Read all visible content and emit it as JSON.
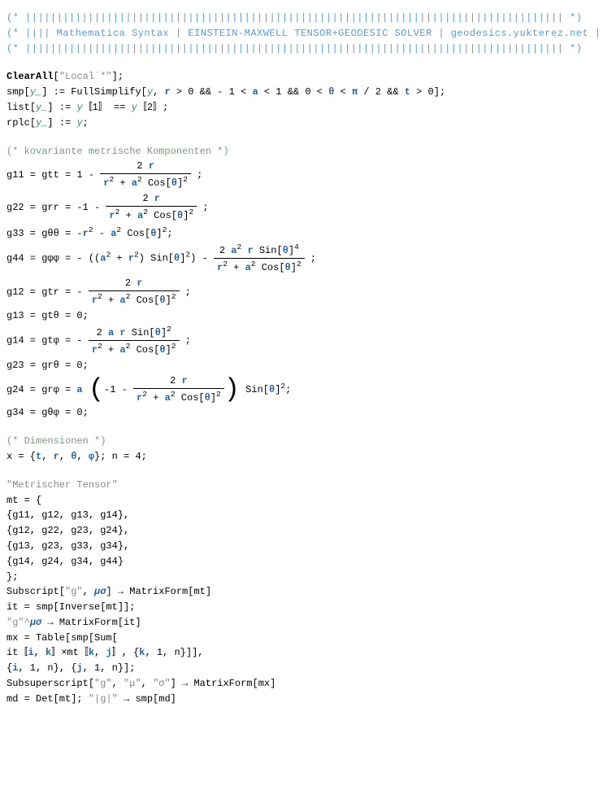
{
  "banner": {
    "line1": "(*  ||||||||||||||||||||||||||||||||||||||||||||||||||||||||||||||||||||||||||||||||||||||  *)",
    "line2": "(*  |||| Mathematica Syntax | EINSTEIN-MAXWELL TENSOR+GEODESIC SOLVER | geodesics.yukterez.net ||||  *)",
    "line3": "(*  ||||||||||||||||||||||||||||||||||||||||||||||||||||||||||||||||||||||||||||||||||||||  *)"
  },
  "code": {
    "clearall": {
      "fn": "ClearAll",
      "arg": "\"Local`*\"",
      "end": ";"
    },
    "smp": {
      "lhs_a": "smp",
      "lhs_b": "[",
      "pat": "y_",
      "lhs_c": "] :=",
      "rhs_a": "FullSimplify",
      "rhs_b": "[",
      "y": "y",
      "sep1": ", ",
      "r": "r",
      "cond1": " > 0 && - 1 < ",
      "a": "a",
      "cond2": " < 1 && 0 < ",
      "th": "θ",
      "cond3": " < ",
      "pi": "π",
      "cond4": " / 2 && ",
      "t": "t",
      "cond5": " > 0];"
    },
    "list": {
      "lhs": "list",
      "pat": "y_",
      "mid": "] := ",
      "y1": "y",
      "br1": "〚1〛 == ",
      "y2": "y",
      "br2": "〚2〛;"
    },
    "rplc": {
      "lhs": "rplc",
      "pat": "y_",
      "mid": "] := ",
      "y": "y",
      "end": ";"
    }
  },
  "section1": "(* kovariante metrische Komponenten *)",
  "metric": {
    "g11_pre": "g11 = gtt = 1 - ",
    "num2r_a": "2 ",
    "num2r_b": "r",
    "den_r": "r",
    "den_sq1": "2",
    "den_plus": " + ",
    "den_a": "a",
    "den_sq2": "2",
    "den_cos": " Cos[",
    "den_th": "θ",
    "den_sqend": "]",
    "den_pow2": "2",
    "end": " ;",
    "g22_pre": "g22 = grr = -1 - ",
    "g33_a": "g33 = gθθ = -",
    "g33_r": "r",
    "g33_b": " - ",
    "g33_a2": "a",
    "g33_c": " Cos[",
    "g33_th": "θ",
    "g33_d": "]",
    "g33_e": ";",
    "g44_a": "g44 = gφφ = - ",
    "g44_op1": "(",
    "g44_op2": "(",
    "g44_aa": "a",
    "g44_plus": " + ",
    "g44_rr": "r",
    "g44_cp2": ")",
    "g44_sin": " Sin[",
    "g44_th": "θ",
    "g44_cb": "]",
    "g44_cp1": ")",
    "g44_minus": " - ",
    "g44_num_a": "2 ",
    "g44_num_b": "a",
    "g44_num_c": " ",
    "g44_num_d": "r",
    "g44_num_e": " Sin[",
    "g44_num_f": "θ",
    "g44_num_g": "]",
    "g44_num_pow4": "4",
    "g12_pre": "g12 = gtr = - ",
    "g13": "g13 = gtθ = 0;",
    "g14_pre": "g14 = gtφ = - ",
    "g14_num_a": "2 ",
    "g14_num_b": "a",
    "g14_num_c": " ",
    "g14_num_d": "r",
    "g14_num_e": " Sin[",
    "g14_num_f": "θ",
    "g14_num_g": "]",
    "g23": "g23 = grθ = 0;",
    "g24_a": "g24 = grφ = ",
    "g24_asym": "a",
    "g24_b": " ",
    "g24_mid": "-1 - ",
    "g24_sin": " Sin[",
    "g24_th": "θ",
    "g24_c": "]",
    "g24_end": ";",
    "g34": "g34 = gθφ = 0;"
  },
  "section2": "(* Dimensionen *)",
  "dims": {
    "pre": "x = {",
    "t": "t",
    "s1": ", ",
    "r": "r",
    "s2": ", ",
    "th": "θ",
    "s3": ", ",
    "ph": "φ",
    "end": "}; n = 4;"
  },
  "tensor_heading": "\"Metrischer Tensor\"",
  "mt": {
    "l1": "mt = {",
    "l2": "{g11, g12, g13, g14},",
    "l3": "{g12, g22, g23, g24},",
    "l4": "{g13, g23, g33, g34},",
    "l5": "{g14, g24, g34, g44}",
    "l6": "};"
  },
  "sub": {
    "a": "Subscript[",
    "g": "\"g\"",
    "b": ", ",
    "mu": "μσ",
    "c": "] → MatrixForm[mt]"
  },
  "it": "it = smp[Inverse[mt]];",
  "gup": {
    "a": "\"g\"^",
    "mu": "μσ",
    "b": " → MatrixForm[it]"
  },
  "mx1": "mx = Table[smp[Sum[",
  "mx2": {
    "a": "it〚",
    "i": "i",
    "b": ", ",
    "k": "k",
    "c": "〛×mt〚",
    "k2": "k",
    "d": ", ",
    "j": "j",
    "e": "〛, {",
    "k3": "k",
    "f": ", 1, n}]],"
  },
  "mx3": {
    "a": "{",
    "i": "i",
    "b": ", 1, n}, {",
    "j": "j",
    "c": ", 1, n}];"
  },
  "subsup": {
    "a": "Subsuperscript[",
    "g": "\"g\"",
    "b": ", ",
    "mu": "\"μ\"",
    "c": ", ",
    "sig": "\"σ\"",
    "d": "] → MatrixForm[mx]"
  },
  "md": {
    "a": "md = Det[mt]; ",
    "g": "\"|g|\"",
    "b": " → smp[md]"
  }
}
